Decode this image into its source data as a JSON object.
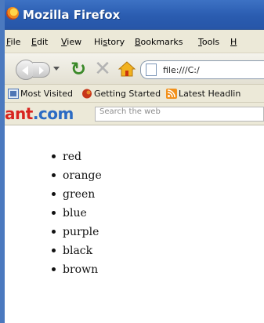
{
  "window": {
    "title": "Mozilla Firefox"
  },
  "menu": [
    {
      "label": "File",
      "key": "F",
      "rest": "ile"
    },
    {
      "label": "Edit",
      "key": "E",
      "rest": "dit"
    },
    {
      "label": "View",
      "key": "V",
      "rest": "iew"
    },
    {
      "label": "History",
      "pre": "Hi",
      "key": "s",
      "rest": "tory"
    },
    {
      "label": "Bookmarks",
      "key": "B",
      "rest": "ookmarks"
    },
    {
      "label": "Tools",
      "key": "T",
      "rest": "ools"
    },
    {
      "label": "Help",
      "key": "H",
      "rest": ""
    }
  ],
  "navigation": {
    "url": "file:///C:/"
  },
  "bookmarks": [
    {
      "label": "Most Visited",
      "icon": "most-visited-icon"
    },
    {
      "label": "Getting Started",
      "icon": "getting-started-icon"
    },
    {
      "label": "Latest Headlin",
      "icon": "rss-feed-icon"
    }
  ],
  "search": {
    "brand_prefix": "a",
    "brand_middle": "nt",
    "brand_dot": ".com",
    "placeholder": "Search the web"
  },
  "page": {
    "list": [
      "red",
      "orange",
      "green",
      "blue",
      "purple",
      "black",
      "brown"
    ]
  },
  "colors": {
    "titlebar": "#2a5cb0",
    "chrome": "#ece9d8",
    "reload": "#3c8a2a",
    "ask_red": "#d8251f",
    "ask_blue": "#2b6bc4"
  }
}
